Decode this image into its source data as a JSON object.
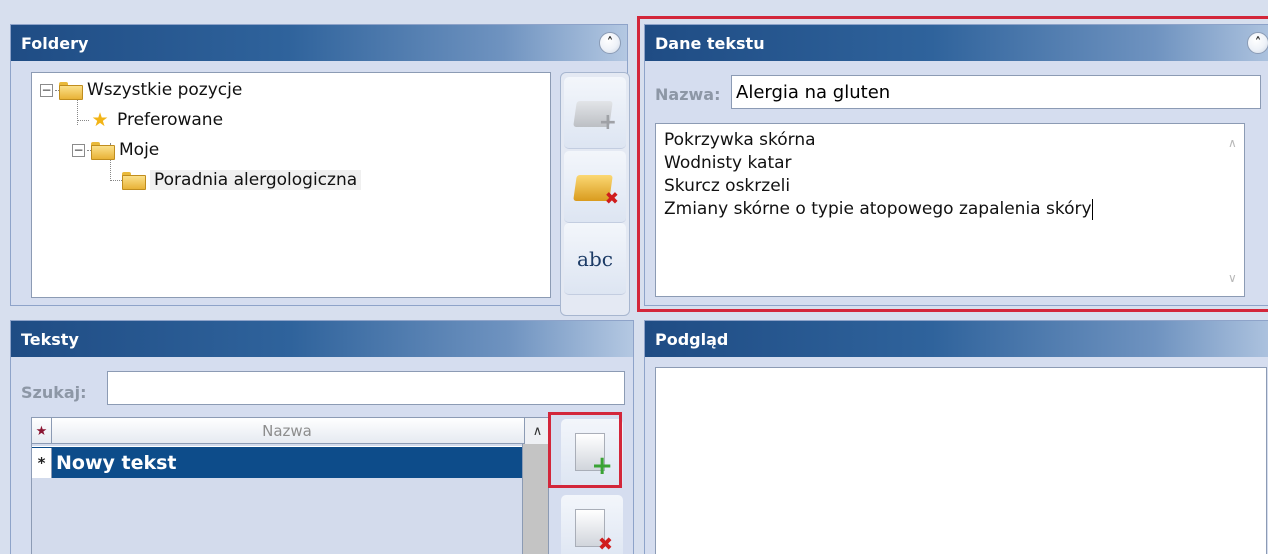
{
  "foldery": {
    "title": "Foldery",
    "collapse_icon": "double-chevron-up-icon",
    "tree": {
      "root_label": "Wszystkie pozycje",
      "items": [
        {
          "label": "Preferowane",
          "icon": "star-icon"
        },
        {
          "label": "Moje",
          "icon": "folder-icon"
        },
        {
          "label": "Poradnia alergologiczna",
          "icon": "folder-icon",
          "selected": true
        }
      ],
      "expander_symbol": "−"
    },
    "buttons": {
      "add_folder_icon": "folder-add-icon",
      "delete_folder_icon": "folder-delete-icon",
      "rename_icon_text": "abc"
    }
  },
  "dane": {
    "title": "Dane tekstu",
    "collapse_icon": "double-chevron-up-icon",
    "name_label": "Nazwa:",
    "name_value": "Alergia na gluten",
    "content_lines": [
      "Pokrzywka skórna",
      "Wodnisty katar",
      "Skurcz oskrzeli",
      "Zmiany skórne o typie atopowego zapalenia skóry"
    ],
    "highlight_color": "#d3263a"
  },
  "teksty": {
    "title": "Teksty",
    "search_label": "Szukaj:",
    "search_value": "",
    "grid": {
      "header_marker": "★",
      "column_title": "Nazwa",
      "rows": [
        {
          "marker": "*",
          "text": "Nowy tekst",
          "selected": true
        }
      ]
    },
    "buttons": {
      "add_text_icon": "document-add-icon",
      "delete_text_icon": "document-delete-icon"
    }
  },
  "podglad": {
    "title": "Podgląd"
  },
  "colors": {
    "header_start": "#1f4c84",
    "header_end": "#b4c8e2",
    "selected_row": "#0d4c8a",
    "background": "#d7dfee"
  }
}
